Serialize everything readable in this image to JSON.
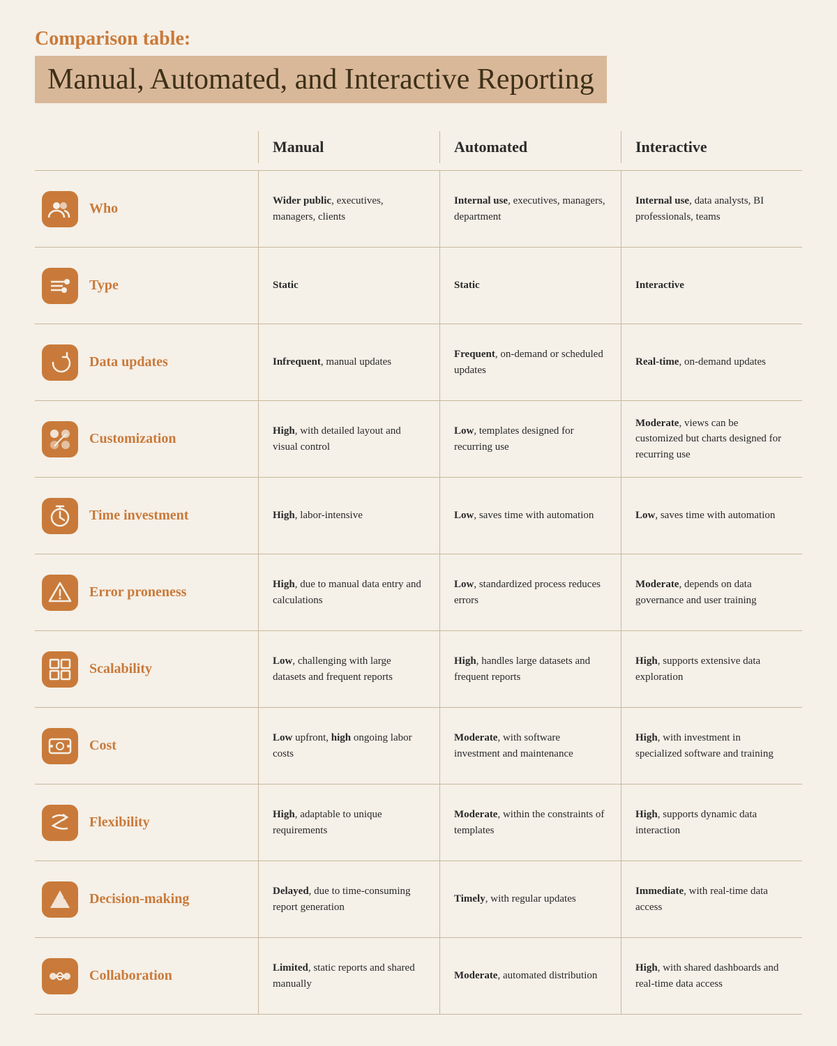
{
  "header": {
    "subtitle": "Comparison table:",
    "title": "Manual, Automated, and Interactive Reporting"
  },
  "columns": {
    "label": "",
    "manual": "Manual",
    "automated": "Automated",
    "interactive": "Interactive"
  },
  "rows": [
    {
      "id": "who",
      "label": "Who",
      "icon": "👥",
      "manual": "<b>Wider public</b>, executives, managers, clients",
      "automated": "<b>Internal use</b>, executives, managers, department",
      "interactive": "<b>Internal use</b>, data analysts, BI professionals, teams"
    },
    {
      "id": "type",
      "label": "Type",
      "icon": "⚙",
      "manual": "<b>Static</b>",
      "automated": "<b>Static</b>",
      "interactive": "<b>Interactive</b>"
    },
    {
      "id": "data-updates",
      "label": "Data updates",
      "icon": "🔄",
      "manual": "<b>Infrequent</b>, manual updates",
      "automated": "<b>Frequent</b>, on-demand or scheduled updates",
      "interactive": "<b>Real-time</b>, on-demand updates"
    },
    {
      "id": "customization",
      "label": "Customization",
      "icon": "🎨",
      "manual": "<b>High</b>, with detailed layout and visual control",
      "automated": "<b>Low</b>, templates designed for recurring use",
      "interactive": "<b>Moderate</b>, views can be customized but charts designed for recurring use"
    },
    {
      "id": "time-investment",
      "label": "Time investment",
      "icon": "⏱",
      "manual": "<b>High</b>, labor-intensive",
      "automated": "<b>Low</b>, saves time with automation",
      "interactive": "<b>Low</b>, saves time with automation"
    },
    {
      "id": "error-proneness",
      "label": "Error proneness",
      "icon": "⚠",
      "manual": "<b>High</b>, due to manual data entry and calculations",
      "automated": "<b>Low</b>, standardized process reduces errors",
      "interactive": "<b>Moderate</b>, depends on data governance and user training"
    },
    {
      "id": "scalability",
      "label": "Scalability",
      "icon": "⤡",
      "manual": "<b>Low</b>, challenging with large datasets and frequent reports",
      "automated": "<b>High</b>, handles large datasets and frequent reports",
      "interactive": "<b>High</b>, supports extensive data exploration"
    },
    {
      "id": "cost",
      "label": "Cost",
      "icon": "💲",
      "manual": "<b>Low</b> upfront, <b>high</b> ongoing labor costs",
      "automated": "<b>Moderate</b>, with software investment and maintenance",
      "interactive": "<b>High</b>, with investment in specialized software and training"
    },
    {
      "id": "flexibility",
      "label": "Flexibility",
      "icon": "↕",
      "manual": "<b>High</b>, adaptable to unique requirements",
      "automated": "<b>Moderate</b>, within the constraints of templates",
      "interactive": "<b>High</b>, supports dynamic data interaction"
    },
    {
      "id": "decision-making",
      "label": "Decision-making",
      "icon": "⚡",
      "manual": "<b>Delayed</b>, due to time-consuming report generation",
      "automated": "<b>Timely</b>, with regular updates",
      "interactive": "<b>Immediate</b>, with real-time data access"
    },
    {
      "id": "collaboration",
      "label": "Collaboration",
      "icon": "↔",
      "manual": "<b>Limited</b>, static reports and shared manually",
      "automated": "<b>Moderate</b>, automated distribution",
      "interactive": "<b>High</b>, with shared dashboards and real-time data access"
    }
  ]
}
